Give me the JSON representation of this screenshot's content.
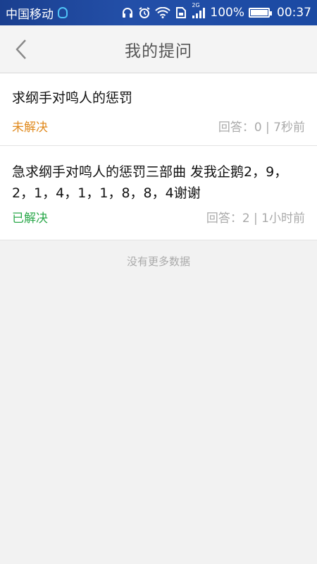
{
  "status_bar": {
    "carrier": "中国移动",
    "network": "2G",
    "battery": "100%",
    "battery_level": 100,
    "time": "00:37",
    "icons": [
      "qq-icon",
      "headphones-icon",
      "alarm-icon",
      "wifi-icon",
      "sim-icon",
      "signal-icon",
      "battery-icon"
    ]
  },
  "header": {
    "title": "我的提问",
    "back_icon": "chevron-left-icon"
  },
  "questions": [
    {
      "text": "求纲手对鸣人的惩罚",
      "status": "未解决",
      "meta": "回答：0 | 7秒前"
    },
    {
      "text": "急求纲手对鸣人的惩罚三部曲 发我企鹅2，9，2，1，4，1，1，8，8，4谢谢",
      "status": "已解决",
      "meta": "回答：2 | 1小时前"
    }
  ],
  "footer": {
    "no_more": "没有更多数据"
  },
  "colors": {
    "status_bar_bg": "#1f4aa3",
    "unsolved": "#e08a1e",
    "solved": "#2aa84a",
    "muted": "#aaaaaa"
  }
}
